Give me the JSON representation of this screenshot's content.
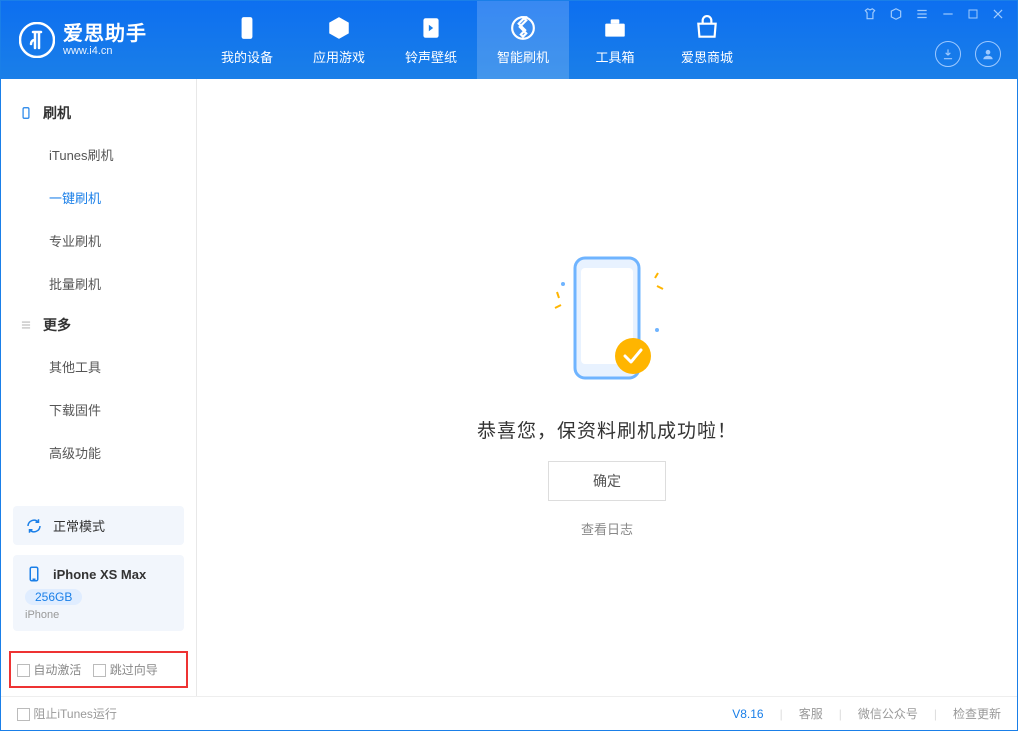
{
  "app": {
    "name": "爱思助手",
    "url": "www.i4.cn",
    "version": "V8.16"
  },
  "nav": {
    "items": [
      {
        "label": "我的设备"
      },
      {
        "label": "应用游戏"
      },
      {
        "label": "铃声壁纸"
      },
      {
        "label": "智能刷机"
      },
      {
        "label": "工具箱"
      },
      {
        "label": "爱思商城"
      }
    ]
  },
  "sidebar": {
    "section1": {
      "title": "刷机",
      "items": [
        "iTunes刷机",
        "一键刷机",
        "专业刷机",
        "批量刷机"
      ]
    },
    "section2": {
      "title": "更多",
      "items": [
        "其他工具",
        "下载固件",
        "高级功能"
      ]
    },
    "mode": {
      "label": "正常模式"
    },
    "device": {
      "name": "iPhone XS Max",
      "storage": "256GB",
      "type": "iPhone"
    },
    "checks": {
      "auto_activate": "自动激活",
      "skip_guide": "跳过向导"
    }
  },
  "main": {
    "success_msg": "恭喜您，保资料刷机成功啦！",
    "ok_label": "确定",
    "log_link": "查看日志"
  },
  "footer": {
    "block_itunes": "阻止iTunes运行",
    "links": [
      "客服",
      "微信公众号",
      "检查更新"
    ]
  }
}
